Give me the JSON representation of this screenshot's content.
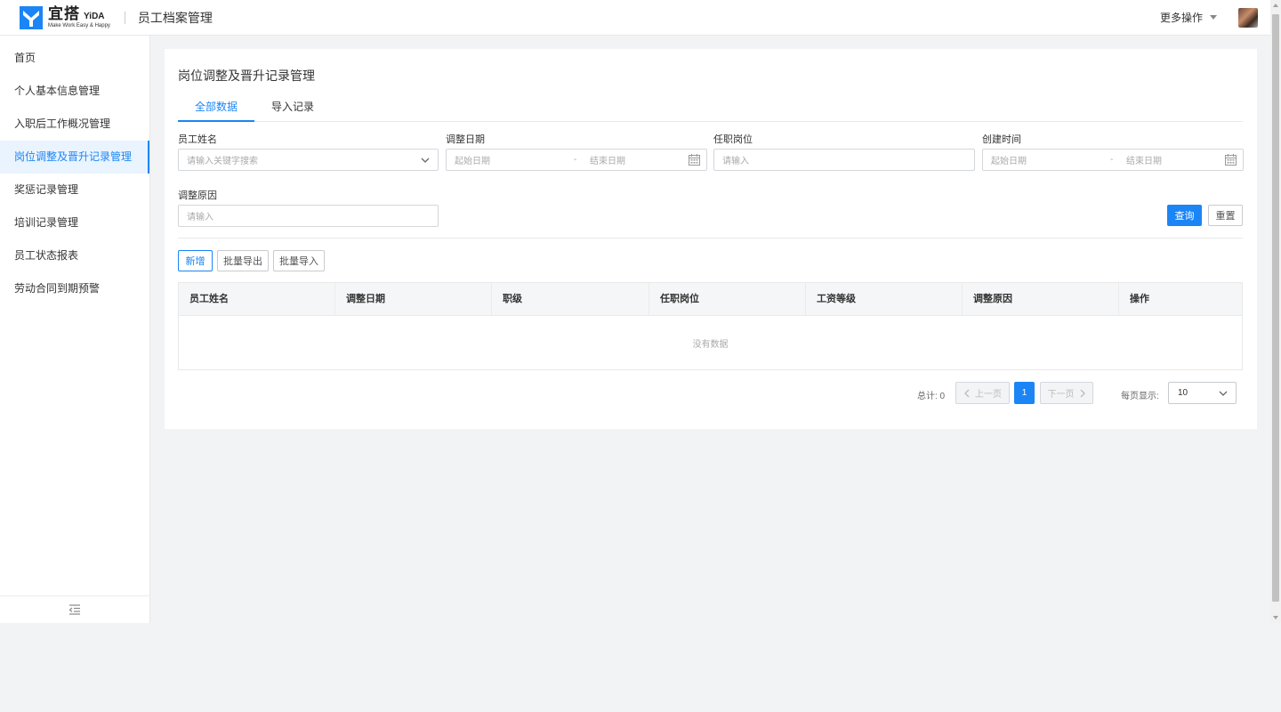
{
  "header": {
    "logo_cn": "宜搭",
    "logo_en": "YiDA",
    "logo_sub": "Make Work Easy & Happy",
    "app_title": "员工档案管理",
    "more_ops": "更多操作"
  },
  "sidebar": {
    "items": [
      {
        "label": "首页"
      },
      {
        "label": "个人基本信息管理"
      },
      {
        "label": "入职后工作概况管理"
      },
      {
        "label": "岗位调整及晋升记录管理"
      },
      {
        "label": "奖惩记录管理"
      },
      {
        "label": "培训记录管理"
      },
      {
        "label": "员工状态报表"
      },
      {
        "label": "劳动合同到期预警"
      }
    ],
    "active_index": 3
  },
  "page": {
    "title": "岗位调整及晋升记录管理",
    "tabs": [
      {
        "label": "全部数据"
      },
      {
        "label": "导入记录"
      }
    ]
  },
  "filters": {
    "employee_name": {
      "label": "员工姓名",
      "placeholder": "请输入关键字搜索"
    },
    "adjust_date": {
      "label": "调整日期",
      "start": "起始日期",
      "sep": "-",
      "end": "结束日期"
    },
    "position": {
      "label": "任职岗位",
      "placeholder": "请输入"
    },
    "created_time": {
      "label": "创建时间",
      "start": "起始日期",
      "sep": "-",
      "end": "结束日期"
    },
    "reason": {
      "label": "调整原因",
      "placeholder": "请输入"
    },
    "query_label": "查询",
    "reset_label": "重置"
  },
  "toolbar": {
    "add_label": "新增",
    "export_label": "批量导出",
    "import_label": "批量导入"
  },
  "table": {
    "columns": [
      "员工姓名",
      "调整日期",
      "职级",
      "任职岗位",
      "工资等级",
      "调整原因",
      "操作"
    ],
    "empty_text": "没有数据"
  },
  "pagination": {
    "total_text": "总计: 0",
    "prev_label": "上一页",
    "current_page": "1",
    "next_label": "下一页",
    "page_size_label": "每页显示:",
    "page_size_value": "10"
  },
  "colors": {
    "accent": "#1b85f5",
    "active_nav_bg": "#eaf4ff"
  }
}
